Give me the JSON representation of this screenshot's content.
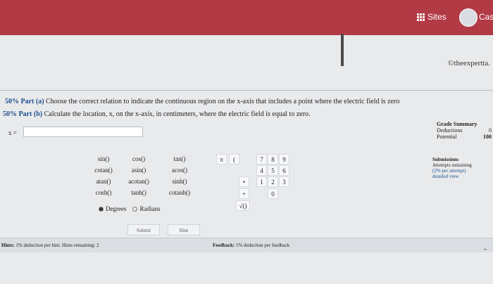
{
  "header": {
    "sites_label": "Sites",
    "user_label": "Cas",
    "brand_text": "©theexpertta."
  },
  "question": {
    "part_a_label": "50% Part (a)",
    "part_a_text": "Choose the correct relation to indicate the continuous region on the x-axis that includes a point where the electric field is zero",
    "part_b_label": "50% Part (b)",
    "part_b_text": "Calculate the location, x, on the x-axis, in centimeters, where the electric field is equal to zero.",
    "x_label": "x =",
    "x_value": ""
  },
  "calculator": {
    "functions": [
      [
        "sin()",
        "cos()",
        "tan()"
      ],
      [
        "cotan()",
        "asin()",
        "acos()"
      ],
      [
        "atan()",
        "acotan()",
        "sinh()"
      ],
      [
        "cosh()",
        "tanh()",
        "cotanh()"
      ]
    ],
    "pi": "π",
    "paren": "(",
    "keys": [
      [
        "7",
        "8",
        "9"
      ],
      [
        "4",
        "5",
        "6"
      ],
      [
        "1",
        "2",
        "3"
      ],
      [
        "",
        "0",
        ""
      ]
    ],
    "dot": "•",
    "plus": "+",
    "sqrt": "√()",
    "degrees": "Degrees",
    "radians": "Radians"
  },
  "grade": {
    "title": "Grade Summary",
    "deductions_label": "Deductions",
    "deductions_value": "0",
    "potential_label": "Potential",
    "potential_value": "100"
  },
  "submissions": {
    "title": "Submissions",
    "attempts": "Attempts remaining",
    "per_attempt": "(2% per attempt)",
    "detailed": "detailed view"
  },
  "actions": {
    "submit": "Submit",
    "hint": "Hint"
  },
  "footer": {
    "hints_label": "Hints:",
    "hints_pct": "1%",
    "hints_text": "deduction per hint. Hints remaining:",
    "hints_remaining": "2",
    "feedback_label": "Feedback:",
    "feedback_pct": "1%",
    "feedback_text": "deduction per feedback"
  },
  "colors": {
    "topbar": "#b23a45",
    "accent": "#1d4f8f"
  }
}
